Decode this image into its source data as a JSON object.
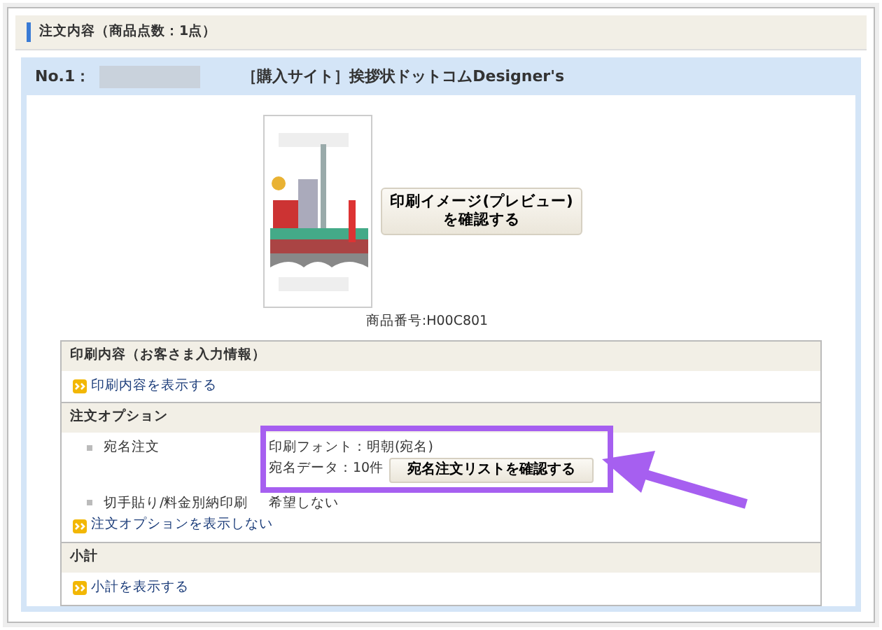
{
  "section_title": "注文内容（商品点数：1点）",
  "order": {
    "number_label": "No.1：",
    "site": "［購入サイト］挨拶状ドットコムDesigner's",
    "preview_button_lines": [
      "印刷イメージ(プレビュー)",
      "を確認する"
    ],
    "product_number": "商品番号:H00C801",
    "sections": [
      {
        "title": "印刷内容（お客さま入力情報）",
        "link": "印刷内容を表示する"
      },
      {
        "title": "注文オプション",
        "options": [
          {
            "label": "宛名注文",
            "values": [
              "印刷フォント：明朝(宛名)",
              "宛名データ：10件"
            ],
            "button": "宛名注文リストを確認する"
          },
          {
            "label": "切手貼り/料金別納印刷",
            "values": [
              "希望しない"
            ]
          }
        ],
        "link": "注文オプションを表示しない"
      },
      {
        "title": "小計",
        "link": "小計を表示する"
      }
    ]
  }
}
